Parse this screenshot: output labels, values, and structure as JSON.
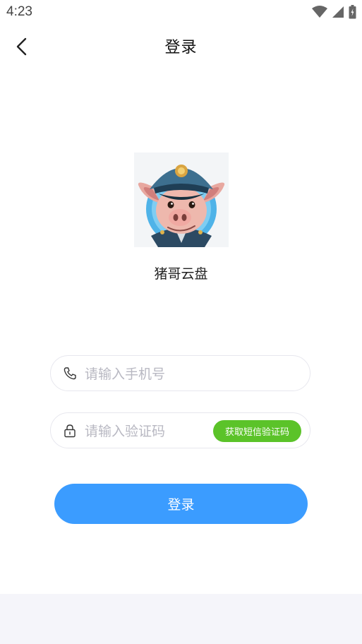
{
  "status_bar": {
    "time": "4:23"
  },
  "nav": {
    "title": "登录"
  },
  "app": {
    "name": "猪哥云盘"
  },
  "form": {
    "phone": {
      "placeholder": "请输入手机号",
      "value": ""
    },
    "code": {
      "placeholder": "请输入验证码",
      "value": ""
    },
    "sms_button_label": "获取短信验证码",
    "login_button_label": "登录"
  },
  "colors": {
    "primary": "#3b9cff",
    "sms_button": "#5bc329",
    "placeholder": "#b8b8c2",
    "footer_bg": "#f5f5fa"
  },
  "icons": {
    "back": "chevron-left-icon",
    "phone": "phone-icon",
    "lock": "lock-icon",
    "wifi": "wifi-icon",
    "signal": "signal-icon",
    "battery": "battery-icon"
  }
}
